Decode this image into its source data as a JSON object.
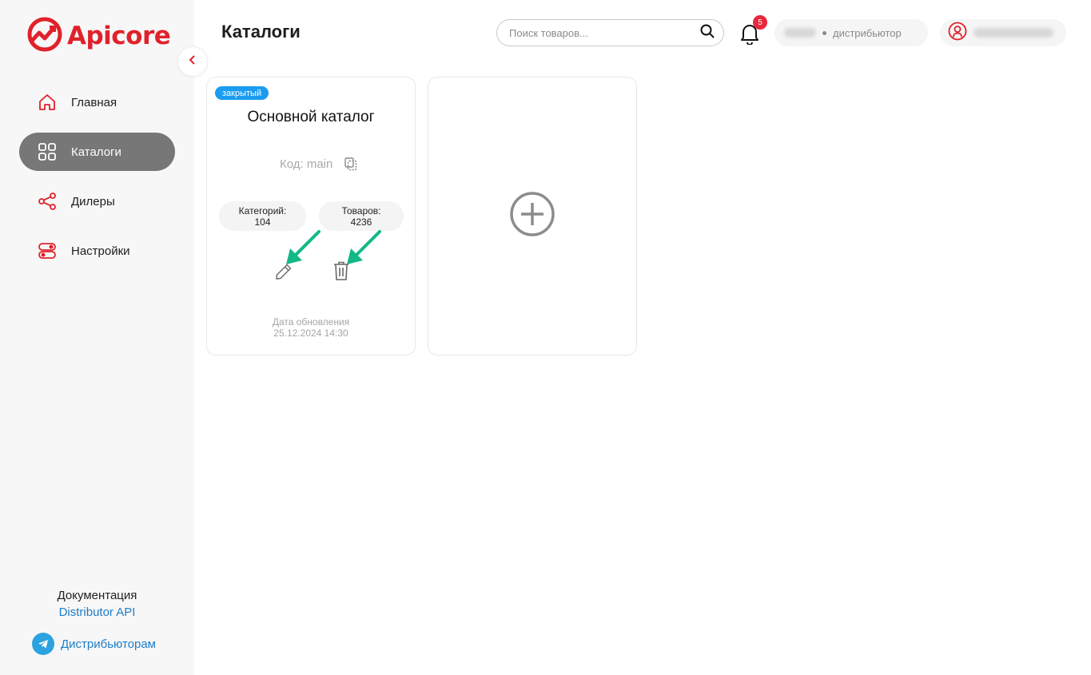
{
  "app": {
    "brand": "Apicore",
    "brand_color": "#e0222b"
  },
  "sidebar": {
    "items": [
      {
        "label": "Главная",
        "icon": "home-icon",
        "active": false
      },
      {
        "label": "Каталоги",
        "icon": "grid-icon",
        "active": true
      },
      {
        "label": "Дилеры",
        "icon": "share-icon",
        "active": false
      },
      {
        "label": "Настройки",
        "icon": "toggle-settings-icon",
        "active": false
      }
    ],
    "docs_title": "Документация",
    "docs_link": "Distributor API",
    "telegram_link": "Дистрибьюторам"
  },
  "header": {
    "title": "Каталоги",
    "search_placeholder": "Поиск товаров...",
    "notifications_count": "5",
    "role": "дистрибьютор"
  },
  "catalogs": [
    {
      "status": "закрытый",
      "status_color": "#1a9cf0",
      "name": "Основной каталог",
      "code_label": "Код: main",
      "categories_label": "Категорий:",
      "categories_count": "104",
      "products_label": "Товаров:",
      "products_count": "4236",
      "updated_label": "Дата обновления",
      "updated_value": "25.12.2024 14:30"
    }
  ],
  "colors": {
    "active_nav": "#777777",
    "link": "#1e7ec8",
    "annotation_arrow": "#12b886",
    "notification_badge": "#e8263c"
  }
}
